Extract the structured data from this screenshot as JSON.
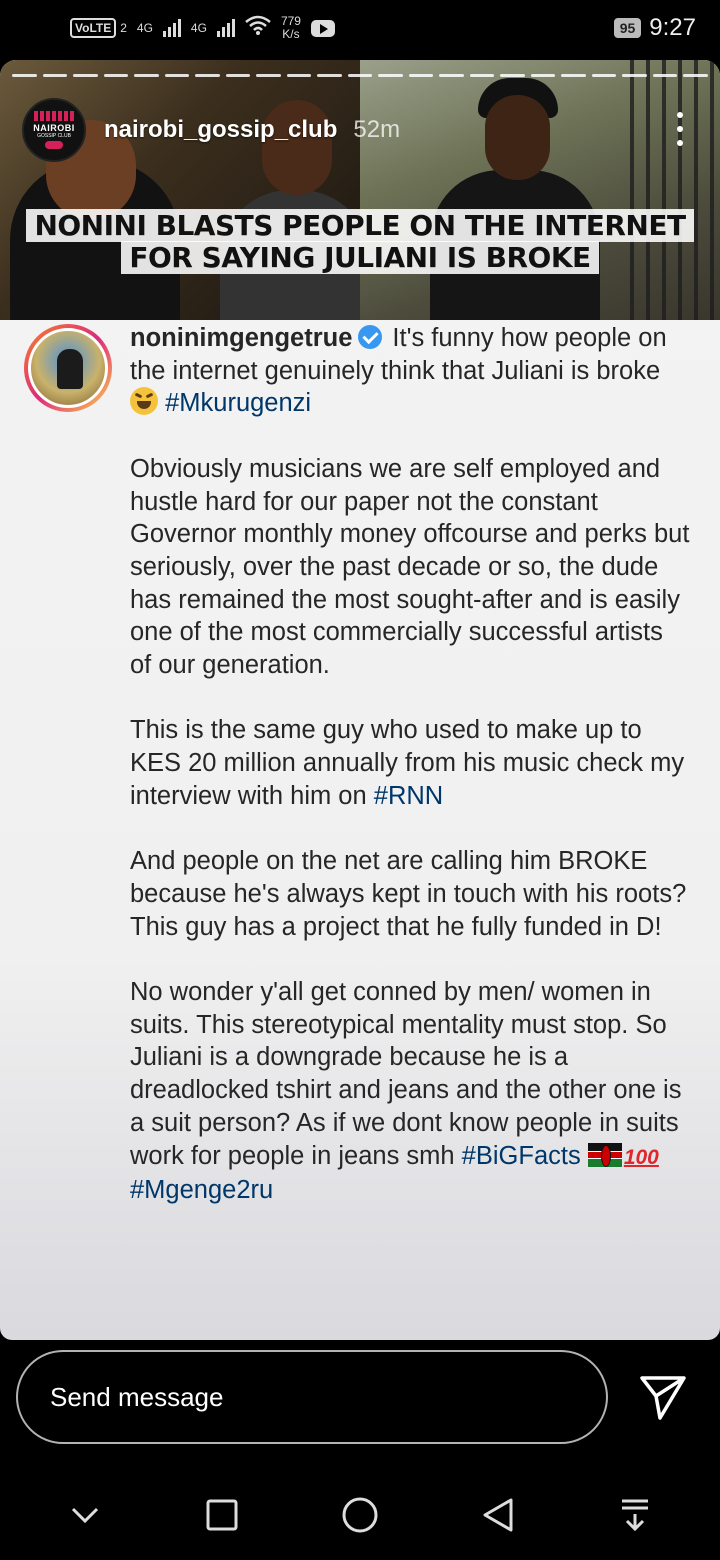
{
  "status_bar": {
    "volte": "VoLTE",
    "sim_index": "2",
    "network_1": "4G",
    "network_2": "4G",
    "speed_value": "779",
    "speed_unit": "K/s",
    "battery": "95",
    "time": "9:27"
  },
  "story": {
    "username": "nairobi_gossip_club",
    "time_ago": "52m",
    "avatar_text": "NAIROBI",
    "avatar_subtext": "GOSSIP CLUB",
    "headline": "NONINI BLASTS PEOPLE ON THE INTERNET FOR SAYING JULIANI IS BROKE",
    "segments": 23
  },
  "post": {
    "username": "noninimgengetrue",
    "intro": "It's funny how people on the internet genuinely think that Juliani is broke",
    "intro_tag": "#Mkurugenzi",
    "para1": "Obviously musicians we are self employed and hustle hard for our paper not the constant Governor monthly money offcourse and perks but seriously, over the past decade or so, the dude has remained the most sought-after and is easily one of the most commercially successful artists of our generation.",
    "para2": "This is the same guy who used to make up to KES 20 million annually from his music check my interview with him on",
    "para2_tag": "#RNN",
    "para3": "And people on the net are calling him BROKE because he's always kept in touch with his roots? This guy has a project that he fully funded in D!",
    "para4": "No wonder y'all get conned by men/ women in suits. This stereotypical mentality must stop. So Juliani is a downgrade because he is a dreadlocked tshirt and jeans and the other one is a suit person? As if we dont know people in suits work for people in jeans smh",
    "tag_bigfacts": "#BiGFacts",
    "emoji_100": "100",
    "tag_mgenge": "#Mgenge2ru"
  },
  "reply": {
    "placeholder": "Send message"
  },
  "nav": {
    "icons": [
      "chevron-down-icon",
      "square-icon",
      "circle-icon",
      "back-triangle-icon",
      "notification-drawer-icon"
    ]
  },
  "colors": {
    "hashtag": "#00376b",
    "verified": "#3897f0",
    "brand_pink": "#d6205a"
  }
}
